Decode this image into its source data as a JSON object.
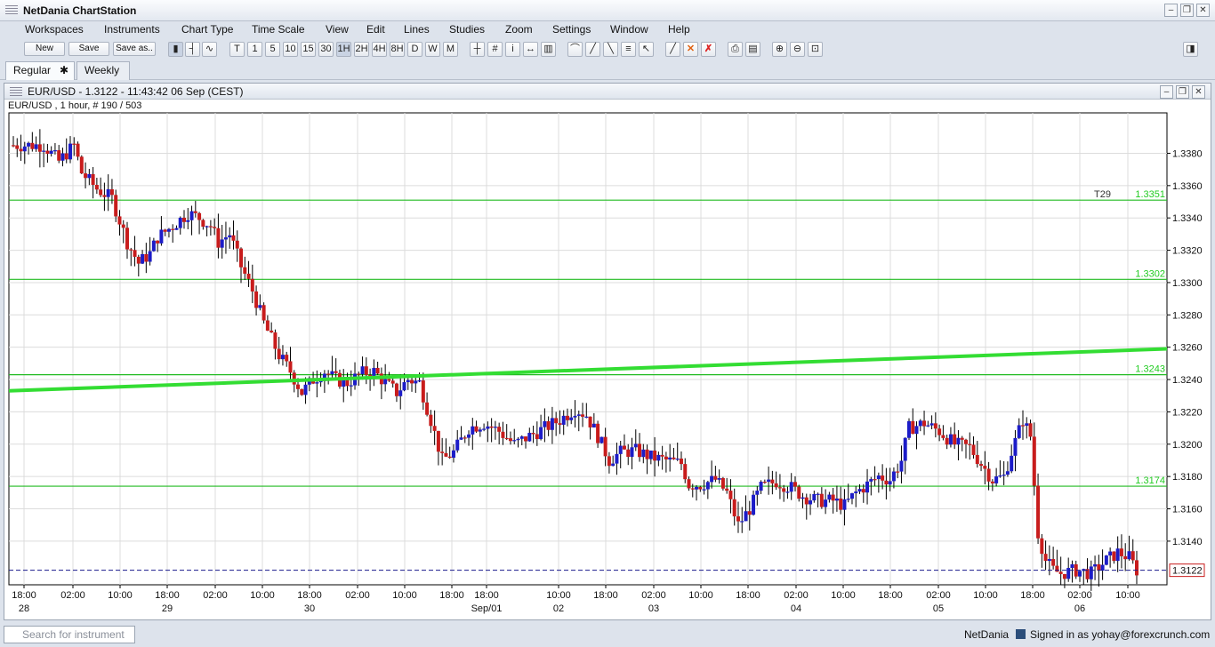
{
  "app": {
    "title": "NetDania ChartStation"
  },
  "menu": [
    "Workspaces",
    "Instruments",
    "Chart Type",
    "Time Scale",
    "View",
    "Edit",
    "Lines",
    "Studies",
    "Zoom",
    "Settings",
    "Window",
    "Help"
  ],
  "toolbar": {
    "new_label": "New",
    "save_label": "Save",
    "saveas_label": "Save as..",
    "timescales": [
      "T",
      "1",
      "5",
      "10",
      "15",
      "30",
      "1H",
      "2H",
      "4H",
      "8H",
      "D",
      "W",
      "M"
    ],
    "active_timescale": "1H"
  },
  "tabs": [
    {
      "label": "Regular",
      "close": "✱"
    },
    {
      "label": "Weekly"
    }
  ],
  "chart_window": {
    "title": "EUR/USD - 1.3122 - 11:43:42  06 Sep (CEST)",
    "subtitle": "EUR/USD , 1 hour, # 190 / 503"
  },
  "chart_data": {
    "type": "candlestick",
    "instrument": "EUR/USD",
    "interval": "1 hour",
    "ylim": [
      1.3113,
      1.3405
    ],
    "yticks": [
      "1.3380",
      "1.3360",
      "1.3340",
      "1.3320",
      "1.3300",
      "1.3280",
      "1.3260",
      "1.3240",
      "1.3220",
      "1.3200",
      "1.3180",
      "1.3160",
      "1.3140"
    ],
    "xticks": [
      {
        "t": "18:00",
        "d": "28"
      },
      {
        "t": "02:00",
        "d": ""
      },
      {
        "t": "10:00",
        "d": ""
      },
      {
        "t": "18:00",
        "d": "29"
      },
      {
        "t": "02:00",
        "d": ""
      },
      {
        "t": "10:00",
        "d": ""
      },
      {
        "t": "18:00",
        "d": "30"
      },
      {
        "t": "02:00",
        "d": ""
      },
      {
        "t": "10:00",
        "d": ""
      },
      {
        "t": "18:00",
        "d": ""
      },
      {
        "t": "18:00",
        "d": "Sep/01"
      },
      {
        "t": "10:00",
        "d": "02"
      },
      {
        "t": "18:00",
        "d": ""
      },
      {
        "t": "02:00",
        "d": "03"
      },
      {
        "t": "10:00",
        "d": ""
      },
      {
        "t": "18:00",
        "d": ""
      },
      {
        "t": "02:00",
        "d": "04"
      },
      {
        "t": "10:00",
        "d": ""
      },
      {
        "t": "18:00",
        "d": ""
      },
      {
        "t": "02:00",
        "d": "05"
      },
      {
        "t": "10:00",
        "d": ""
      },
      {
        "t": "18:00",
        "d": ""
      },
      {
        "t": "02:00",
        "d": "06"
      },
      {
        "t": "10:00",
        "d": ""
      }
    ],
    "horizontal_lines": [
      {
        "label": "1.3351",
        "value": 1.3351,
        "marker": "T29"
      },
      {
        "label": "1.3302",
        "value": 1.3302
      },
      {
        "label": "1.3243",
        "value": 1.3243
      },
      {
        "label": "1.3174",
        "value": 1.3174
      }
    ],
    "trendline": {
      "start": 1.3233,
      "end": 1.3259
    },
    "last_price": {
      "label": "1.3122",
      "value": 1.3122
    },
    "colors": {
      "up": "#1c1cc8",
      "down": "#c81c1c",
      "level_line": "#22bb22",
      "trendline": "#33dd33",
      "last_price": "#1a1a8c",
      "grid": "#dcdcdc",
      "level_label": "#22cc22"
    },
    "anchors": [
      [
        0,
        1.3385
      ],
      [
        8,
        1.3385
      ],
      [
        12,
        1.3375
      ],
      [
        16,
        1.3385
      ],
      [
        18,
        1.3368
      ],
      [
        22,
        1.3358
      ],
      [
        26,
        1.3352
      ],
      [
        30,
        1.3325
      ],
      [
        33,
        1.3312
      ],
      [
        36,
        1.3318
      ],
      [
        38,
        1.3328
      ],
      [
        42,
        1.3335
      ],
      [
        46,
        1.3343
      ],
      [
        49,
        1.334
      ],
      [
        52,
        1.3335
      ],
      [
        54,
        1.3325
      ],
      [
        57,
        1.333
      ],
      [
        60,
        1.331
      ],
      [
        63,
        1.3295
      ],
      [
        66,
        1.3275
      ],
      [
        68,
        1.3265
      ],
      [
        70,
        1.3255
      ],
      [
        73,
        1.3245
      ],
      [
        76,
        1.3232
      ],
      [
        79,
        1.324
      ],
      [
        82,
        1.3245
      ],
      [
        85,
        1.324
      ],
      [
        88,
        1.3238
      ],
      [
        92,
        1.3244
      ],
      [
        95,
        1.3245
      ],
      [
        98,
        1.3238
      ],
      [
        101,
        1.3232
      ],
      [
        104,
        1.324
      ],
      [
        107,
        1.3238
      ],
      [
        110,
        1.3215
      ],
      [
        113,
        1.319
      ],
      [
        116,
        1.3195
      ],
      [
        120,
        1.321
      ],
      [
        124,
        1.3213
      ],
      [
        128,
        1.3208
      ],
      [
        132,
        1.32
      ],
      [
        136,
        1.3205
      ],
      [
        140,
        1.321
      ],
      [
        144,
        1.3215
      ],
      [
        148,
        1.3222
      ],
      [
        151,
        1.3218
      ],
      [
        154,
        1.3205
      ],
      [
        157,
        1.319
      ],
      [
        160,
        1.3195
      ],
      [
        164,
        1.3196
      ],
      [
        168,
        1.3192
      ],
      [
        172,
        1.319
      ],
      [
        176,
        1.3188
      ],
      [
        178,
        1.3175
      ],
      [
        181,
        1.3175
      ],
      [
        185,
        1.3178
      ],
      [
        188,
        1.317
      ],
      [
        191,
        1.315
      ],
      [
        194,
        1.316
      ],
      [
        197,
        1.3173
      ],
      [
        201,
        1.3177
      ],
      [
        205,
        1.3173
      ],
      [
        208,
        1.3168
      ],
      [
        212,
        1.3165
      ],
      [
        216,
        1.3165
      ],
      [
        219,
        1.3162
      ],
      [
        222,
        1.317
      ],
      [
        225,
        1.3175
      ],
      [
        228,
        1.318
      ],
      [
        231,
        1.3178
      ],
      [
        234,
        1.319
      ],
      [
        236,
        1.321
      ],
      [
        240,
        1.3213
      ],
      [
        244,
        1.3208
      ],
      [
        248,
        1.32
      ],
      [
        252,
        1.3198
      ],
      [
        255,
        1.3188
      ],
      [
        258,
        1.3178
      ],
      [
        261,
        1.318
      ],
      [
        263,
        1.3195
      ],
      [
        266,
        1.3215
      ],
      [
        268,
        1.3205
      ],
      [
        270,
        1.3145
      ],
      [
        272,
        1.3128
      ],
      [
        274,
        1.3122
      ],
      [
        276,
        1.312
      ],
      [
        280,
        1.3122
      ],
      [
        284,
        1.312
      ],
      [
        288,
        1.3128
      ],
      [
        291,
        1.3133
      ],
      [
        294,
        1.313
      ],
      [
        296,
        1.3122
      ]
    ]
  },
  "status": {
    "search_placeholder": "Search for instrument",
    "provider": "NetDania",
    "signed_in": "Signed in as yohay@forexcrunch.com"
  }
}
